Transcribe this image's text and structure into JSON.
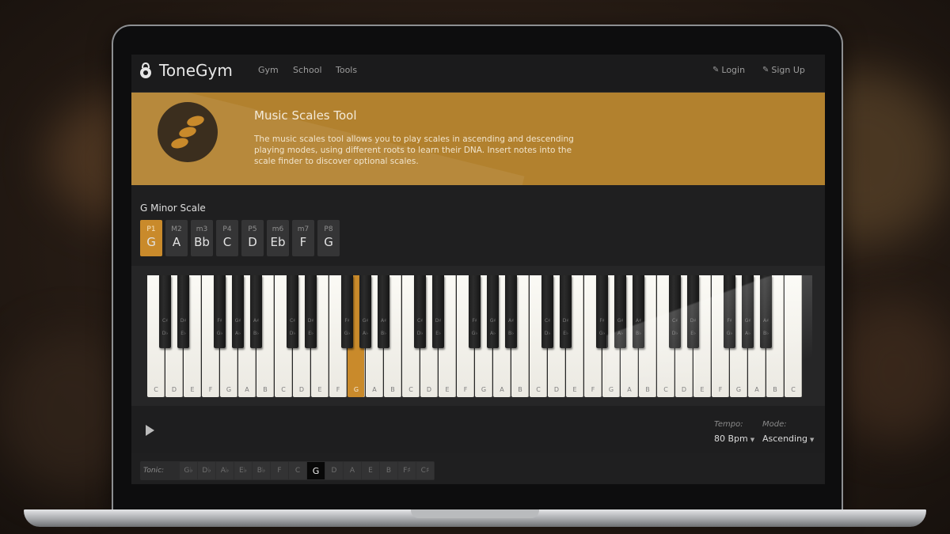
{
  "nav": {
    "brand": "ToneGym",
    "links": [
      "Gym",
      "School",
      "Tools"
    ],
    "login": "Login",
    "signup": "Sign Up"
  },
  "banner": {
    "title": "Music Scales Tool",
    "description": "The music scales tool allows you to play scales in ascending and descending playing modes, using different roots to learn their DNA. Insert notes into the scale finder to discover optional scales."
  },
  "scale": {
    "title": "G Minor Scale",
    "intervals": [
      {
        "label": "P1",
        "note": "G",
        "active": true
      },
      {
        "label": "M2",
        "note": "A"
      },
      {
        "label": "m3",
        "note": "Bb"
      },
      {
        "label": "P4",
        "note": "C"
      },
      {
        "label": "P5",
        "note": "D"
      },
      {
        "label": "m6",
        "note": "Eb"
      },
      {
        "label": "m7",
        "note": "F"
      },
      {
        "label": "P8",
        "note": "G"
      }
    ]
  },
  "piano": {
    "white_keys": [
      "C",
      "D",
      "E",
      "F",
      "G",
      "A",
      "B",
      "C",
      "D",
      "E",
      "F",
      "G",
      "A",
      "B",
      "C",
      "D",
      "E",
      "F",
      "G",
      "A",
      "B",
      "C",
      "D",
      "E",
      "F",
      "G",
      "A",
      "B",
      "C",
      "D",
      "E",
      "F",
      "G",
      "A",
      "B",
      "C"
    ],
    "black_key_labels": [
      [
        "C♯",
        "D♭"
      ],
      [
        "D♯",
        "E♭"
      ],
      [
        "F♯",
        "G♭"
      ],
      [
        "G♯",
        "A♭"
      ],
      [
        "A♯",
        "B♭"
      ]
    ],
    "highlighted_white_index": 11,
    "accent": "#c98a2b"
  },
  "controls": {
    "tempo_label": "Tempo:",
    "tempo_value": "80 Bpm",
    "mode_label": "Mode:",
    "mode_value": "Ascending"
  },
  "tonic": {
    "label": "Tonic:",
    "notes": [
      "G♭",
      "D♭",
      "A♭",
      "E♭",
      "B♭",
      "F",
      "C",
      "G",
      "D",
      "A",
      "E",
      "B",
      "F♯",
      "C♯"
    ],
    "selected": "G"
  }
}
